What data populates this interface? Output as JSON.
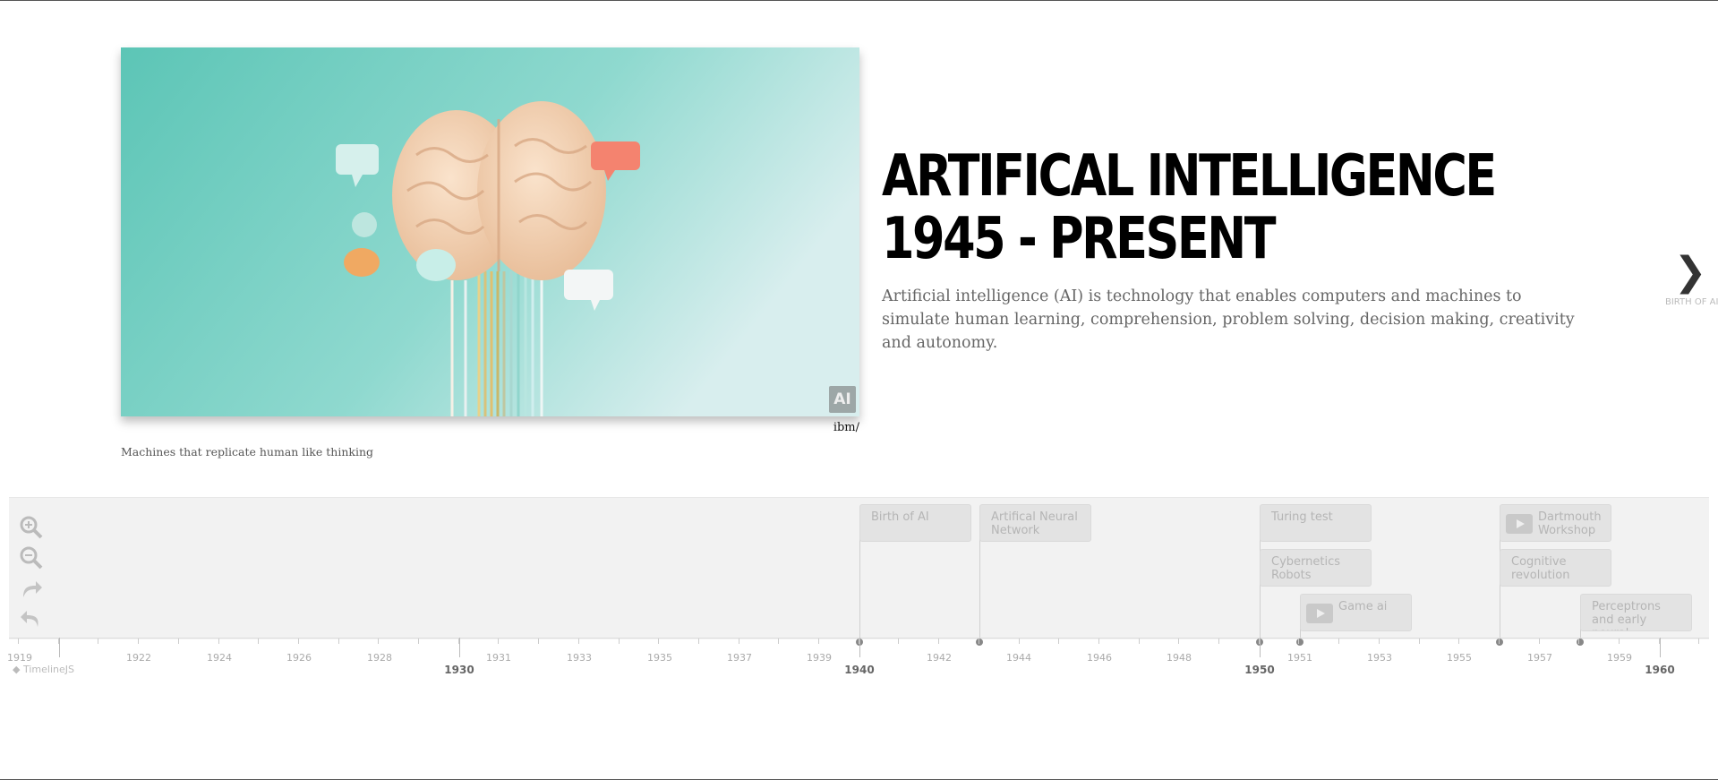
{
  "slide": {
    "headline_line1": "ARTIFICAL INTELLIGENCE",
    "headline_line2": "1945 - PRESENT",
    "body": "Artificial intelligence (AI) is technology that enables computers and machines to simulate human learning, comprehension, problem solving, decision making, creativity and autonomy.",
    "media_badge": "AI",
    "credit": "ibm/",
    "caption": "Machines that replicate human like thinking"
  },
  "next": {
    "label": "BIRTH OF AI",
    "icon": "chevron-right-icon"
  },
  "tools": [
    "zoom-in-icon",
    "zoom-out-icon",
    "forward-icon",
    "back-icon"
  ],
  "markers": [
    {
      "title": "Birth of AI",
      "video": false
    },
    {
      "title": "Artifical Neural Network",
      "video": false
    },
    {
      "title": "Turing test",
      "video": false
    },
    {
      "title": "Cybernetics Robots",
      "video": false
    },
    {
      "title": "Game ai",
      "video": true
    },
    {
      "title": "Dartmouth Workshop",
      "video": true
    },
    {
      "title": "Cognitive revolution",
      "video": false
    },
    {
      "title": "Perceptrons and early neural...",
      "video": false
    }
  ],
  "axis": {
    "minor_labels": [
      "1919",
      "1922",
      "1924",
      "1926",
      "1928",
      "1931",
      "1933",
      "1935",
      "1937",
      "1939",
      "1942",
      "1944",
      "1946",
      "1948",
      "1951",
      "1953",
      "1955",
      "1957",
      "1959"
    ],
    "major_labels": [
      "1930",
      "1940",
      "1950",
      "1960"
    ]
  },
  "brand": "TimelineJS",
  "colors": {
    "marker_bg": "#e3e3e3",
    "nav_bg": "#f2f2f2",
    "headline": "#000000",
    "media_teal": "#7fd3c8"
  }
}
